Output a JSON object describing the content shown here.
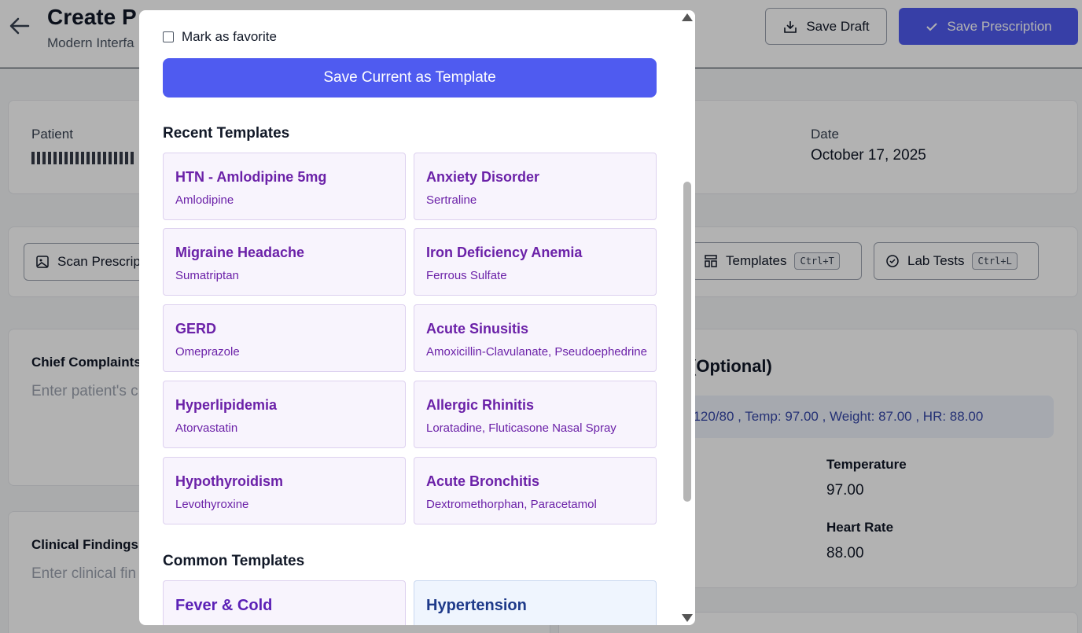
{
  "header": {
    "title": "Create P",
    "subtitle": "Modern Interfa",
    "save_draft_label": "Save Draft",
    "save_prescription_label": "Save Prescription"
  },
  "patient_card": {
    "patient_label": "Patient",
    "date_label": "Date",
    "date_value": "October 17, 2025"
  },
  "toolbar": {
    "scan_label": "Scan Prescrip",
    "templates_label": "Templates",
    "templates_shortcut": "Ctrl+T",
    "lab_tests_label": "Lab Tests",
    "lab_tests_shortcut": "Ctrl+L"
  },
  "complaints": {
    "label": "Chief Complaints",
    "placeholder": "Enter patient's c"
  },
  "findings": {
    "label": "Clinical Findings",
    "placeholder": "Enter clinical fin"
  },
  "vitals": {
    "heading": "(Optional)",
    "summary": ": 120/80 , Temp: 97.00 , Weight: 87.00 , HR: 88.00",
    "temperature_label": "Temperature",
    "temperature_value": "97.00",
    "heart_rate_label": "Heart Rate",
    "heart_rate_value": "88.00"
  },
  "modal": {
    "favorite_label": "Mark as favorite",
    "save_template_label": "Save Current as Template",
    "recent_heading": "Recent Templates",
    "common_heading": "Common Templates",
    "recent_templates": [
      {
        "name": "HTN - Amlodipine 5mg",
        "meds": "Amlodipine"
      },
      {
        "name": "Anxiety Disorder",
        "meds": "Sertraline"
      },
      {
        "name": "Migraine Headache",
        "meds": "Sumatriptan"
      },
      {
        "name": "Iron Deficiency Anemia",
        "meds": "Ferrous Sulfate"
      },
      {
        "name": "GERD",
        "meds": "Omeprazole"
      },
      {
        "name": "Acute Sinusitis",
        "meds": "Amoxicillin-Clavulanate, Pseudoephedrine"
      },
      {
        "name": "Hyperlipidemia",
        "meds": "Atorvastatin"
      },
      {
        "name": "Allergic Rhinitis",
        "meds": "Loratadine, Fluticasone Nasal Spray"
      },
      {
        "name": "Hypothyroidism",
        "meds": "Levothyroxine"
      },
      {
        "name": "Acute Bronchitis",
        "meds": "Dextromethorphan, Paracetamol"
      }
    ],
    "common_templates": [
      {
        "name": "Fever & Cold"
      },
      {
        "name": "Hypertension"
      }
    ]
  },
  "colors": {
    "primary": "#4f5bf0",
    "template_title": "#6b21a8",
    "template_bg": "#f8f4fd"
  }
}
